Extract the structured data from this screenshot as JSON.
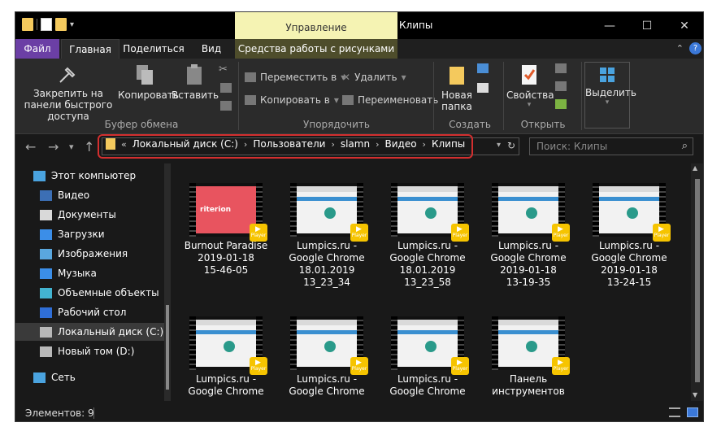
{
  "window": {
    "title": "Клипы",
    "context_tab_header": "Управление",
    "controls": {
      "minimize": "—",
      "maximize": "☐",
      "close": "✕"
    }
  },
  "tabs": {
    "file": "Файл",
    "home": "Главная",
    "share": "Поделиться",
    "view": "Вид",
    "picture_tools": "Средства работы с рисунками"
  },
  "ribbon": {
    "pin_quick_access": "Закрепить на панели быстрого доступа",
    "copy": "Копировать",
    "paste": "Вставить",
    "clipboard_group": "Буфер обмена",
    "move_to": "Переместить в",
    "copy_to": "Копировать в",
    "delete": "Удалить",
    "rename": "Переименовать",
    "organize_group": "Упорядочить",
    "new_folder": "Новая папка",
    "create_group": "Создать",
    "properties": "Свойства",
    "open_group": "Открыть",
    "select": "Выделить"
  },
  "address": {
    "overflow": "«",
    "crumbs": [
      "Локальный диск (C:)",
      "Пользователи",
      "slamn",
      "Видео",
      "Клипы"
    ],
    "search_placeholder": "Поиск: Клипы"
  },
  "sidebar": {
    "items": [
      {
        "label": "Этот компьютер",
        "icon": "computer-icon"
      },
      {
        "label": "Видео",
        "icon": "video-folder-icon"
      },
      {
        "label": "Документы",
        "icon": "documents-icon"
      },
      {
        "label": "Загрузки",
        "icon": "download-icon"
      },
      {
        "label": "Изображения",
        "icon": "pictures-icon"
      },
      {
        "label": "Музыка",
        "icon": "music-icon"
      },
      {
        "label": "Объемные объекты",
        "icon": "3d-objects-icon"
      },
      {
        "label": "Рабочий стол",
        "icon": "desktop-icon"
      },
      {
        "label": "Локальный диск (C:)",
        "icon": "drive-icon"
      },
      {
        "label": "Новый том (D:)",
        "icon": "drive-icon"
      },
      {
        "label": "Сеть",
        "icon": "network-icon"
      }
    ]
  },
  "files": [
    {
      "lines": [
        "Burnout Paradise",
        "2019-01-18",
        "15-46-05"
      ],
      "thumb": "red",
      "thumb_text": "riterion",
      "badge": "Player"
    },
    {
      "lines": [
        "Lumpics.ru -",
        "Google Chrome",
        "18.01.2019",
        "13_23_34"
      ],
      "thumb": "web",
      "badge": "Player"
    },
    {
      "lines": [
        "Lumpics.ru -",
        "Google Chrome",
        "18.01.2019",
        "13_23_58"
      ],
      "thumb": "web",
      "badge": "Player"
    },
    {
      "lines": [
        "Lumpics.ru -",
        "Google Chrome",
        "2019-01-18",
        "13-19-35"
      ],
      "thumb": "web",
      "badge": "Player"
    },
    {
      "lines": [
        "Lumpics.ru -",
        "Google Chrome",
        "2019-01-18",
        "13-24-15"
      ],
      "thumb": "web",
      "badge": "Player"
    },
    {
      "lines": [
        "Lumpics.ru -",
        "Google Chrome"
      ],
      "thumb": "web",
      "badge": "Player"
    },
    {
      "lines": [
        "Lumpics.ru -",
        "Google Chrome"
      ],
      "thumb": "web",
      "badge": "Player"
    },
    {
      "lines": [
        "Lumpics.ru -",
        "Google Chrome"
      ],
      "thumb": "web",
      "badge": "Player"
    },
    {
      "lines": [
        "Панель",
        "инструментов"
      ],
      "thumb": "web",
      "badge": "Player"
    }
  ],
  "status": {
    "items_count": "Элементов: 9"
  },
  "colors": {
    "accent_file_tab": "#6b3fa5",
    "context_tab": "#f5f3b3",
    "highlight": "#d32f2f",
    "badge": "#f6c400"
  }
}
